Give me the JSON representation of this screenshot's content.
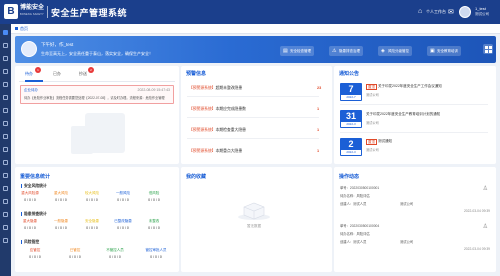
{
  "header": {
    "brand": "博能安全",
    "brand_sub": "BONENG SAFETY",
    "system_title": "安全生产管理系统",
    "workspace": "个人工作台",
    "user_name": "1_test",
    "user_role": "测试公司"
  },
  "tabs": {
    "home": "首页"
  },
  "banner": {
    "greeting": "下午好，作_test",
    "slogan": "生命至高无上，安全责任重于泰山，落实安全，确保生产安全！",
    "quick_actions": [
      "安全检查管理",
      "隐患排查治理",
      "风险分级管控",
      "安全教育培训"
    ]
  },
  "tasks": {
    "tabs": [
      {
        "label": "待办",
        "badge": "1"
      },
      {
        "label": "已办",
        "badge": ""
      },
      {
        "label": "抄送",
        "badge": "2"
      }
    ],
    "item": {
      "title": "企业待办",
      "time": "2022-08-09 15:47:43",
      "desc": "待办【危险作业审批】流程任务需要您处理【2022-07-08】，请及时办理。流程来源：危险作业管理"
    }
  },
  "warnings": {
    "title": "预警信息",
    "rows": [
      {
        "source": "【预警源系统】",
        "name": "超期未整改隐患",
        "count": "23"
      },
      {
        "source": "【预警源系统】",
        "name": "本期应完成隐患数",
        "count": "1"
      },
      {
        "source": "【预警源系统】",
        "name": "本期检查重大隐患",
        "count": "1"
      },
      {
        "source": "【预警源系统】",
        "name": "本期重点大隐患",
        "count": "1"
      }
    ]
  },
  "notices": {
    "title": "通知公告",
    "items": [
      {
        "day": "7",
        "ym": "2022-7",
        "tag": "置顶",
        "title": "关于印发2022年度安全生产工作会议通知",
        "org": "测试公司"
      },
      {
        "day": "31",
        "ym": "2022-3",
        "tag": "",
        "title": "关于印发2022年度安全生产教育培训计划的通知",
        "org": "测试公司"
      },
      {
        "day": "2",
        "ym": "2022-3",
        "tag": "置顶",
        "title": "测试通知",
        "org": "测试公司"
      }
    ]
  },
  "stats": {
    "title": "重要信息统计",
    "groups": [
      {
        "name": "安全风险统计",
        "labels": [
          "重大风险源",
          "重大风险",
          "较大风险",
          "一般风险",
          "低风险"
        ],
        "colors": [
          "#e04a2a",
          "#f08a24",
          "#e8c020",
          "#1b5fd6",
          "#2aa24a"
        ],
        "values": [
          "0 / 0 / 0",
          "0 / 0 / 0",
          "0 / 0 / 0",
          "0 / 0 / 0",
          "0 / 0 / 0"
        ]
      },
      {
        "name": "隐患排查统计",
        "labels": [
          "重大隐患",
          "一般隐患",
          "安全隐患",
          "已整改隐患",
          "未整改"
        ],
        "colors": [
          "#e04a2a",
          "#f08a24",
          "#e8c020",
          "#1b5fd6",
          "#2aa24a"
        ],
        "values": [
          "0 / 0 / 0",
          "0 / 0 / 0",
          "0 / 0 / 0",
          "0 / 0 / 0",
          "0 / 0 / 0"
        ]
      },
      {
        "name": "风险管控",
        "labels": [
          "应管控",
          "已管控",
          "不管控人员",
          "管控审批人员"
        ],
        "colors": [
          "#e04a2a",
          "#f08a24",
          "#2aa24a",
          "#1b5fd6"
        ],
        "values": [
          "0 / 0 / 0",
          "0 / 0 / 0",
          "0 / 0 / 0",
          "0 / 0 / 0"
        ]
      }
    ]
  },
  "my_apps": {
    "title": "我的收藏",
    "empty": "暂无数据"
  },
  "dynamics": {
    "title": "操作动态",
    "items": [
      {
        "no": "单号：2022030500100001",
        "type": "待办名称：风险评估",
        "person": "创建人：测试人员",
        "org": "测试公司",
        "time": "2022-03-04 09:39"
      },
      {
        "no": "单号：2022030500100004",
        "type": "待办名称：风险评估",
        "person": "创建人：测试人员",
        "org": "测试公司",
        "time": "2022-03-04 09:39"
      }
    ]
  }
}
